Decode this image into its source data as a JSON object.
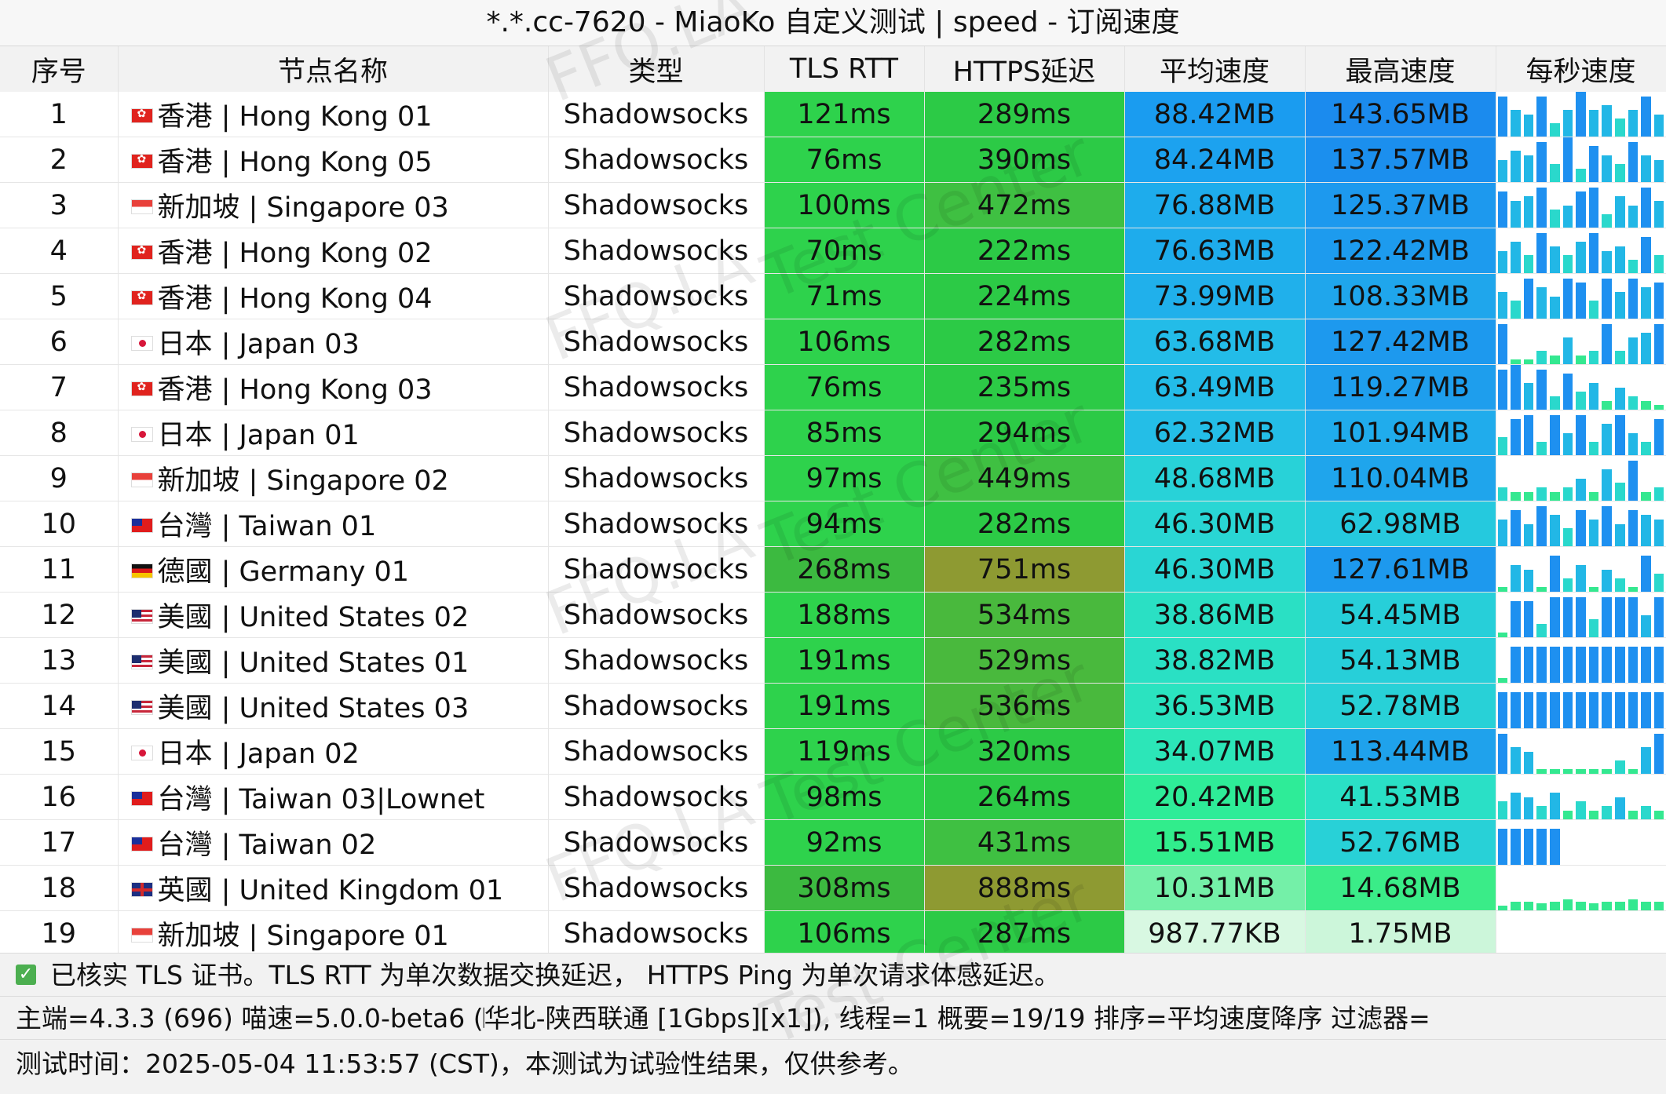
{
  "title": "*.*.cc-7620 - MiaoKo 自定义测试 | speed - 订阅速度",
  "columns": [
    "序号",
    "节点名称",
    "类型",
    "TLS RTT",
    "HTTPS延迟",
    "平均速度",
    "最高速度",
    "每秒速度"
  ],
  "rows": [
    {
      "idx": "1",
      "flag": "hk",
      "name": "香港 | Hong Kong 01",
      "type": "Shadowsocks",
      "tls": "121ms",
      "https": "289ms",
      "avg": "88.42MB",
      "max": "143.65MB",
      "avg_color": "#1a9cf0",
      "max_color": "#1b8bee",
      "spark": [
        0.9,
        0.6,
        0.5,
        0.9,
        0.3,
        0.6,
        1.0,
        0.6,
        0.7,
        0.4,
        0.6,
        0.9,
        0.5
      ]
    },
    {
      "idx": "2",
      "flag": "hk",
      "name": "香港 | Hong Kong 05",
      "type": "Shadowsocks",
      "tls": "76ms",
      "https": "390ms",
      "avg": "84.24MB",
      "max": "137.57MB",
      "avg_color": "#1ca2ef",
      "max_color": "#1b8fee",
      "spark": [
        0.5,
        0.7,
        0.6,
        0.9,
        0.4,
        1.0,
        0.3,
        0.8,
        0.6,
        0.4,
        0.9,
        0.6,
        0.5
      ]
    },
    {
      "idx": "3",
      "flag": "sg",
      "name": "新加坡 | Singapore 03",
      "type": "Shadowsocks",
      "tls": "100ms",
      "https": "472ms",
      "avg": "76.88MB",
      "max": "125.37MB",
      "avg_color": "#1eacec",
      "max_color": "#1d99ee",
      "spark": [
        0.8,
        0.6,
        0.7,
        0.9,
        0.4,
        0.5,
        0.8,
        0.9,
        0.3,
        0.7,
        0.5,
        0.9,
        0.6
      ]
    },
    {
      "idx": "4",
      "flag": "hk",
      "name": "香港 | Hong Kong 02",
      "type": "Shadowsocks",
      "tls": "70ms",
      "https": "222ms",
      "avg": "76.63MB",
      "max": "122.42MB",
      "avg_color": "#1eacec",
      "max_color": "#1d9bee",
      "spark": [
        0.5,
        0.7,
        0.4,
        0.9,
        0.6,
        0.4,
        0.7,
        0.9,
        0.5,
        0.6,
        0.3,
        0.8,
        0.4
      ]
    },
    {
      "idx": "5",
      "flag": "hk",
      "name": "香港 | Hong Kong 04",
      "type": "Shadowsocks",
      "tls": "71ms",
      "https": "224ms",
      "avg": "73.99MB",
      "max": "108.33MB",
      "avg_color": "#20b0eb",
      "max_color": "#1fa6ec",
      "spark": [
        0.6,
        0.4,
        0.9,
        0.7,
        0.5,
        0.9,
        0.8,
        0.4,
        0.9,
        0.6,
        0.9,
        0.7,
        0.8
      ]
    },
    {
      "idx": "6",
      "flag": "jp",
      "name": "日本 | Japan 03",
      "type": "Shadowsocks",
      "tls": "106ms",
      "https": "282ms",
      "avg": "63.68MB",
      "max": "127.42MB",
      "avg_color": "#23bce8",
      "max_color": "#1d99ee",
      "spark": [
        0.9,
        0.1,
        0.1,
        0.3,
        0.2,
        0.6,
        0.2,
        0.3,
        0.9,
        0.3,
        0.6,
        0.7,
        0.9
      ]
    },
    {
      "idx": "7",
      "flag": "hk",
      "name": "香港 | Hong Kong 03",
      "type": "Shadowsocks",
      "tls": "76ms",
      "https": "235ms",
      "avg": "63.49MB",
      "max": "119.27MB",
      "avg_color": "#23bce8",
      "max_color": "#1e9eed",
      "spark": [
        0.9,
        1.0,
        0.6,
        0.9,
        0.3,
        0.8,
        0.4,
        0.6,
        0.2,
        0.5,
        0.3,
        0.2,
        0.1
      ]
    },
    {
      "idx": "8",
      "flag": "jp",
      "name": "日本 | Japan 01",
      "type": "Shadowsocks",
      "tls": "85ms",
      "https": "294ms",
      "avg": "62.32MB",
      "max": "101.94MB",
      "avg_color": "#24bee7",
      "max_color": "#20acec",
      "spark": [
        0.4,
        0.8,
        0.9,
        0.3,
        0.9,
        0.5,
        0.9,
        0.3,
        0.7,
        0.9,
        0.5,
        0.3,
        0.8
      ]
    },
    {
      "idx": "9",
      "flag": "sg",
      "name": "新加坡 | Singapore 02",
      "type": "Shadowsocks",
      "tls": "97ms",
      "https": "449ms",
      "avg": "48.68MB",
      "max": "110.04MB",
      "avg_color": "#28d2d8",
      "max_color": "#1fa5ec",
      "spark": [
        0.3,
        0.2,
        0.2,
        0.3,
        0.2,
        0.3,
        0.5,
        0.2,
        0.7,
        0.4,
        0.9,
        0.2,
        0.3
      ]
    },
    {
      "idx": "10",
      "flag": "tw",
      "name": "台灣 | Taiwan 01",
      "type": "Shadowsocks",
      "tls": "94ms",
      "https": "282ms",
      "avg": "46.30MB",
      "max": "62.98MB",
      "avg_color": "#29d6d4",
      "max_color": "#25c9de",
      "spark": [
        0.6,
        0.8,
        0.5,
        0.9,
        0.7,
        0.4,
        0.8,
        0.6,
        0.9,
        0.5,
        0.8,
        0.7,
        0.6
      ]
    },
    {
      "idx": "11",
      "flag": "de",
      "name": "德國 | Germany 01",
      "type": "Shadowsocks",
      "tls": "268ms",
      "https": "751ms",
      "avg": "46.30MB",
      "max": "127.61MB",
      "avg_color": "#29d6d4",
      "max_color": "#1d99ee",
      "spark": [
        0.1,
        0.6,
        0.5,
        0.1,
        0.8,
        0.3,
        0.6,
        0.1,
        0.5,
        0.3,
        0.1,
        0.8,
        0.4
      ]
    },
    {
      "idx": "12",
      "flag": "us",
      "name": "美國 | United States 02",
      "type": "Shadowsocks",
      "tls": "188ms",
      "https": "534ms",
      "avg": "38.86MB",
      "max": "54.45MB",
      "avg_color": "#2ae0c4",
      "max_color": "#27cfd9",
      "spark": [
        0.1,
        0.8,
        0.8,
        0.3,
        0.9,
        0.9,
        0.9,
        0.4,
        0.9,
        0.9,
        0.9,
        0.5,
        0.9
      ]
    },
    {
      "idx": "13",
      "flag": "us",
      "name": "美國 | United States 01",
      "type": "Shadowsocks",
      "tls": "191ms",
      "https": "529ms",
      "avg": "38.82MB",
      "max": "54.13MB",
      "avg_color": "#2ae0c4",
      "max_color": "#27cfd9",
      "spark": [
        0.1,
        0.8,
        0.8,
        0.8,
        0.8,
        0.8,
        0.8,
        0.8,
        0.8,
        0.8,
        0.8,
        0.8,
        0.8
      ]
    },
    {
      "idx": "14",
      "flag": "us",
      "name": "美國 | United States 03",
      "type": "Shadowsocks",
      "tls": "191ms",
      "https": "536ms",
      "avg": "36.53MB",
      "max": "52.78MB",
      "avg_color": "#2be3c0",
      "max_color": "#28d1d7",
      "spark": [
        0.8,
        0.8,
        0.8,
        0.8,
        0.8,
        0.8,
        0.8,
        0.8,
        0.8,
        0.8,
        0.8,
        0.8,
        0.8
      ]
    },
    {
      "idx": "15",
      "flag": "jp",
      "name": "日本 | Japan 02",
      "type": "Shadowsocks",
      "tls": "119ms",
      "https": "320ms",
      "avg": "34.07MB",
      "max": "113.44MB",
      "avg_color": "#2ce6b8",
      "max_color": "#1fa2ec",
      "spark": [
        0.9,
        0.6,
        0.5,
        0.1,
        0.1,
        0.1,
        0.1,
        0.1,
        0.1,
        0.3,
        0.1,
        0.6,
        0.9
      ]
    },
    {
      "idx": "16",
      "flag": "tw",
      "name": "台灣 | Taiwan 03|Lownet",
      "type": "Shadowsocks",
      "tls": "98ms",
      "https": "264ms",
      "avg": "20.42MB",
      "max": "41.53MB",
      "avg_color": "#2eec98",
      "max_color": "#2ae0c6",
      "spark": [
        0.4,
        0.6,
        0.5,
        0.3,
        0.6,
        0.2,
        0.4,
        0.2,
        0.3,
        0.5,
        0.2,
        0.3,
        0.2
      ]
    },
    {
      "idx": "17",
      "flag": "tw",
      "name": "台灣 | Taiwan 02",
      "type": "Shadowsocks",
      "tls": "92ms",
      "https": "431ms",
      "avg": "15.51MB",
      "max": "52.76MB",
      "avg_color": "#31ed8c",
      "max_color": "#28d1d7",
      "spark": [
        0.8,
        0.8,
        0.8,
        0.8,
        0.8,
        0,
        0,
        0,
        0,
        0,
        0,
        0,
        0
      ]
    },
    {
      "idx": "18",
      "flag": "gb",
      "name": "英國 | United Kingdom 01",
      "type": "Shadowsocks",
      "tls": "308ms",
      "https": "888ms",
      "avg": "10.31MB",
      "max": "14.68MB",
      "avg_color": "#74f0a8",
      "max_color": "#3aec88",
      "spark": [
        0.1,
        0.2,
        0.2,
        0.15,
        0.2,
        0.25,
        0.2,
        0.15,
        0.2,
        0.2,
        0.25,
        0.2,
        0.2
      ]
    },
    {
      "idx": "19",
      "flag": "sg",
      "name": "新加坡 | Singapore 01",
      "type": "Shadowsocks",
      "tls": "106ms",
      "https": "287ms",
      "avg": "987.77KB",
      "max": "1.75MB",
      "avg_color": "#d8f8e2",
      "max_color": "#ccf6da",
      "spark": [
        0,
        0,
        0,
        0,
        0,
        0,
        0,
        0,
        0,
        0,
        0,
        0,
        0
      ]
    }
  ],
  "footer": {
    "line1": "已核实 TLS 证书。TLS RTT 为单次数据交换延迟， HTTPS Ping 为单次请求体感延迟。",
    "line2": "主端=4.3.3 (696) 喵速=5.0.0-beta6 (𝄀华北-陕西联通 [1Gbps][x1]), 线程=1 概要=19/19 排序=平均速度降序 过滤器=",
    "line3": "测试时间：2025-05-04 11:53:57 (CST)，本测试为试验性结果，仅供参考。"
  },
  "watermark": [
    "FFQ.LA",
    "Test Center"
  ],
  "colors": {
    "tls_good": "#2ed24c",
    "https_good": "#2cca46",
    "latency_bad": "#8e9a32",
    "latency_mid": "#4aba3e"
  }
}
